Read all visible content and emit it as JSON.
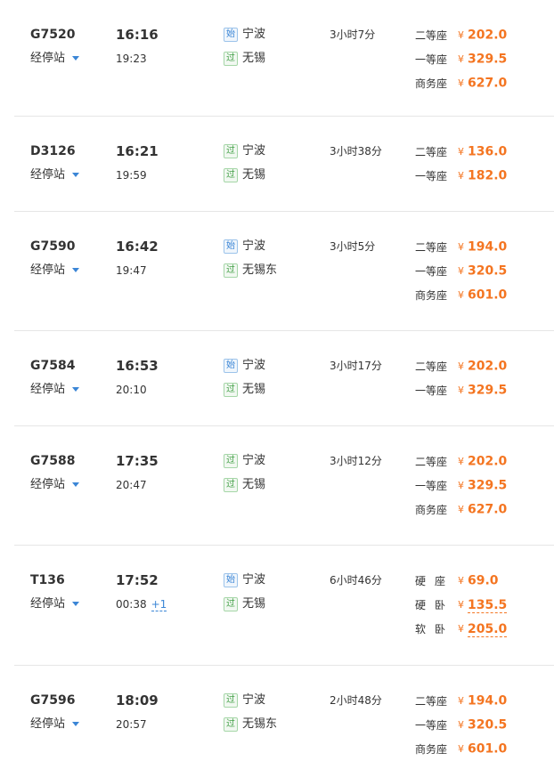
{
  "icons": {
    "stops_caret": "caret-down-icon",
    "start_tag": "始",
    "pass_tag": "过",
    "currency": "¥"
  },
  "colors": {
    "price": "#f47521",
    "link": "#3b86d6",
    "start_tag": "#3b86d6",
    "pass_tag": "#43a047",
    "divider": "#e6e6e6"
  },
  "trains": [
    {
      "number": "G7520",
      "stops_label": "经停站",
      "depart": "16:16",
      "arrive": "19:23",
      "from": {
        "tag": "始",
        "tag_type": "start",
        "name": "宁波"
      },
      "to": {
        "tag": "过",
        "tag_type": "pass",
        "name": "无锡"
      },
      "duration": "3小时7分",
      "seats": [
        {
          "name": "二等座",
          "currency": "¥",
          "price": "202.0"
        },
        {
          "name": "一等座",
          "currency": "¥",
          "price": "329.5"
        },
        {
          "name": "商务座",
          "currency": "¥",
          "price": "627.0"
        }
      ]
    },
    {
      "number": "D3126",
      "stops_label": "经停站",
      "depart": "16:21",
      "arrive": "19:59",
      "from": {
        "tag": "过",
        "tag_type": "pass",
        "name": "宁波"
      },
      "to": {
        "tag": "过",
        "tag_type": "pass",
        "name": "无锡"
      },
      "duration": "3小时38分",
      "seats": [
        {
          "name": "二等座",
          "currency": "¥",
          "price": "136.0"
        },
        {
          "name": "一等座",
          "currency": "¥",
          "price": "182.0"
        }
      ]
    },
    {
      "number": "G7590",
      "stops_label": "经停站",
      "depart": "16:42",
      "arrive": "19:47",
      "from": {
        "tag": "始",
        "tag_type": "start",
        "name": "宁波"
      },
      "to": {
        "tag": "过",
        "tag_type": "pass",
        "name": "无锡东"
      },
      "duration": "3小时5分",
      "seats": [
        {
          "name": "二等座",
          "currency": "¥",
          "price": "194.0"
        },
        {
          "name": "一等座",
          "currency": "¥",
          "price": "320.5"
        },
        {
          "name": "商务座",
          "currency": "¥",
          "price": "601.0"
        }
      ]
    },
    {
      "number": "G7584",
      "stops_label": "经停站",
      "depart": "16:53",
      "arrive": "20:10",
      "from": {
        "tag": "始",
        "tag_type": "start",
        "name": "宁波"
      },
      "to": {
        "tag": "过",
        "tag_type": "pass",
        "name": "无锡"
      },
      "duration": "3小时17分",
      "seats": [
        {
          "name": "二等座",
          "currency": "¥",
          "price": "202.0"
        },
        {
          "name": "一等座",
          "currency": "¥",
          "price": "329.5"
        }
      ]
    },
    {
      "number": "G7588",
      "stops_label": "经停站",
      "depart": "17:35",
      "arrive": "20:47",
      "from": {
        "tag": "过",
        "tag_type": "pass",
        "name": "宁波"
      },
      "to": {
        "tag": "过",
        "tag_type": "pass",
        "name": "无锡"
      },
      "duration": "3小时12分",
      "seats": [
        {
          "name": "二等座",
          "currency": "¥",
          "price": "202.0"
        },
        {
          "name": "一等座",
          "currency": "¥",
          "price": "329.5"
        },
        {
          "name": "商务座",
          "currency": "¥",
          "price": "627.0"
        }
      ]
    },
    {
      "number": "T136",
      "stops_label": "经停站",
      "depart": "17:52",
      "arrive": "00:38",
      "arrive_extra": "+1",
      "from": {
        "tag": "始",
        "tag_type": "start",
        "name": "宁波"
      },
      "to": {
        "tag": "过",
        "tag_type": "pass",
        "name": "无锡"
      },
      "duration": "6小时46分",
      "seats": [
        {
          "name": "硬座",
          "currency": "¥",
          "price": "69.0",
          "spaced": true
        },
        {
          "name": "硬卧",
          "currency": "¥",
          "price": "135.5",
          "spaced": true,
          "dashed": true
        },
        {
          "name": "软卧",
          "currency": "¥",
          "price": "205.0",
          "spaced": true,
          "dashed": true
        }
      ]
    },
    {
      "number": "G7596",
      "stops_label": "经停站",
      "depart": "18:09",
      "arrive": "20:57",
      "from": {
        "tag": "过",
        "tag_type": "pass",
        "name": "宁波"
      },
      "to": {
        "tag": "过",
        "tag_type": "pass",
        "name": "无锡东"
      },
      "duration": "2小时48分",
      "seats": [
        {
          "name": "二等座",
          "currency": "¥",
          "price": "194.0"
        },
        {
          "name": "一等座",
          "currency": "¥",
          "price": "320.5"
        },
        {
          "name": "商务座",
          "currency": "¥",
          "price": "601.0"
        }
      ]
    }
  ]
}
